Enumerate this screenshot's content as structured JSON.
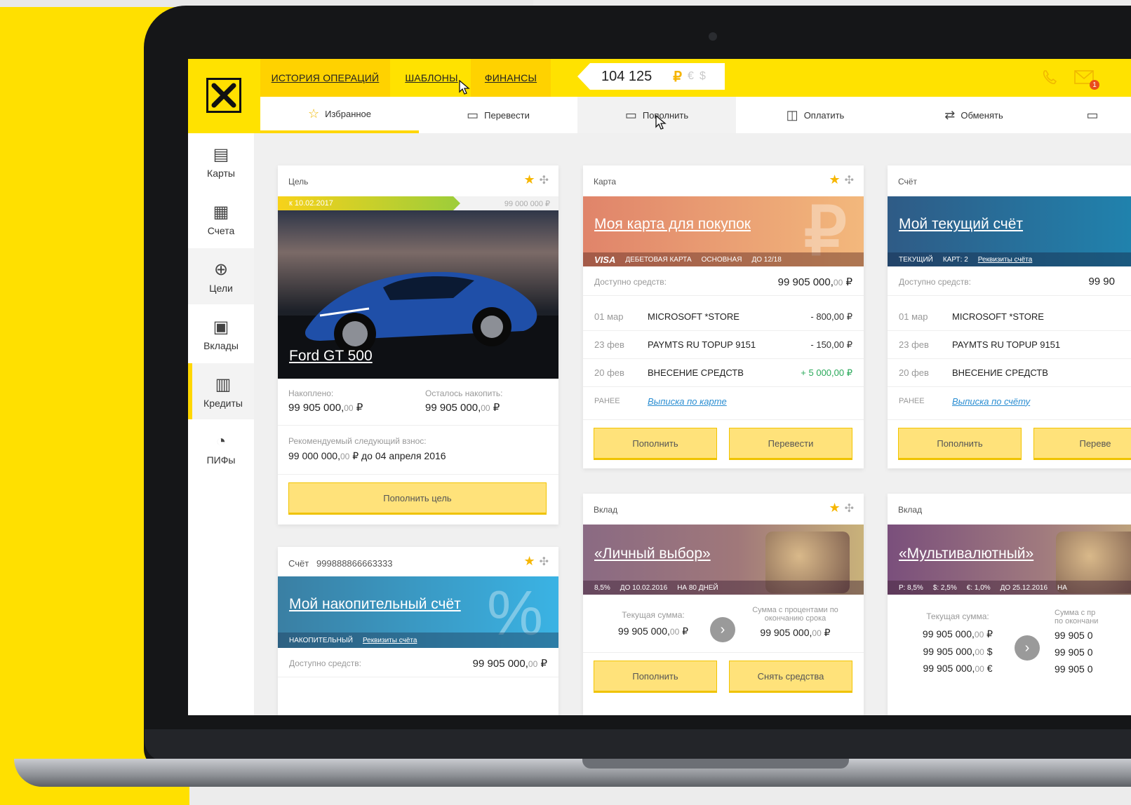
{
  "header": {
    "tabs": [
      {
        "label": "ИСТОРИЯ ОПЕРАЦИЙ"
      },
      {
        "label": "ШАБЛОНЫ"
      },
      {
        "label": "ФИНАНСЫ"
      }
    ],
    "balance": {
      "value": "104 125",
      "currency_active": "₽",
      "currency_alt1": "€",
      "currency_alt2": "$"
    },
    "mail_badge": "1"
  },
  "actions": [
    {
      "label": "Избранное",
      "icon": "star-icon"
    },
    {
      "label": "Перевести",
      "icon": "transfer-icon"
    },
    {
      "label": "Пополнить",
      "icon": "topup-icon"
    },
    {
      "label": "Оплатить",
      "icon": "pay-icon"
    },
    {
      "label": "Обменять",
      "icon": "exchange-icon"
    }
  ],
  "sidebar": [
    {
      "label": "Карты",
      "icon": "cards-icon"
    },
    {
      "label": "Счета",
      "icon": "accounts-icon"
    },
    {
      "label": "Цели",
      "icon": "goals-icon"
    },
    {
      "label": "Вклады",
      "icon": "deposits-icon"
    },
    {
      "label": "Кредиты",
      "icon": "credits-icon"
    },
    {
      "label": "ПИФы",
      "icon": "funds-icon"
    }
  ],
  "goal_card": {
    "type": "Цель",
    "date": "к 10.02.2017",
    "target": "99 000 000 ₽",
    "progress": 0.65,
    "title": "Ford GT 500",
    "saved_label": "Накоплено:",
    "saved_int": "99 905 000,",
    "saved_dec": "00",
    "saved_cur": "₽",
    "left_label": "Осталось накопить:",
    "left_int": "99 905 000,",
    "left_dec": "00",
    "left_cur": "₽",
    "rec_label": "Рекомендуемый следующий взнос:",
    "rec_int": "99 000 000,",
    "rec_dec": "00",
    "rec_tail": "₽ до 04 апреля 2016",
    "button": "Пополнить цель"
  },
  "savings_card": {
    "type": "Счёт",
    "number": "999888866663333",
    "title": "Мой накопительный счёт",
    "strip_kind": "накопительный",
    "strip_link": "Реквизиты счёта",
    "avail_label": "Доступно средств:",
    "avail_int": "99 905 000,",
    "avail_dec": "00",
    "avail_cur": "₽"
  },
  "card_card": {
    "type": "Карта",
    "title": "Моя карта для покупок",
    "strip": [
      "VISA",
      "ДЕБЕТОВАЯ КАРТА",
      "ОСНОВНАЯ",
      "ДО 12/18"
    ],
    "avail_label": "Доступно средств:",
    "avail_int": "99 905 000,",
    "avail_dec": "00",
    "avail_cur": "₽",
    "transactions": [
      {
        "date": "01 мар",
        "name": "MICROSOFT *STORE",
        "amount": "- 800,00 ₽"
      },
      {
        "date": "23 фев",
        "name": "PAYMTS RU TOPUP 9151",
        "amount": "- 150,00 ₽"
      },
      {
        "date": "20 фев",
        "name": "ВНЕСЕНИЕ СРЕДСТВ",
        "amount": "+ 5 000,00 ₽"
      }
    ],
    "earlier": "РАНЕЕ",
    "statement": "Выписка по карте",
    "btn1": "Пополнить",
    "btn2": "Перевести"
  },
  "current_card": {
    "type": "Счёт",
    "title": "Мой текущий счёт",
    "strip": [
      "ТЕКУЩИЙ",
      "КАРТ: 2",
      "Реквизиты счёта"
    ],
    "avail_label": "Доступно средств:",
    "avail_value": "99 90",
    "transactions": [
      {
        "date": "01 мар",
        "name": "MICROSOFT *STORE"
      },
      {
        "date": "23 фев",
        "name": "PAYMTS RU TOPUP 9151"
      },
      {
        "date": "20 фев",
        "name": "ВНЕСЕНИЕ СРЕДСТВ"
      }
    ],
    "earlier": "РАНЕЕ",
    "statement": "Выписка по счёту",
    "btn1": "Пополнить",
    "btn2": "Переве"
  },
  "deposit1": {
    "type": "Вклад",
    "title": "«Личный выбор»",
    "strip": [
      "8,5%",
      "ДО 10.02.2016",
      "НА 80 ДНЕЙ"
    ],
    "cur_label": "Текущая сумма:",
    "cur_int": "99 905 000,",
    "cur_dec": "00",
    "cur_cur": "₽",
    "end_label": "Сумма с процентами по окончанию срока",
    "end_int": "99 905 000,",
    "end_dec": "00",
    "end_cur": "₽",
    "btn1": "Пополнить",
    "btn2": "Снять средства"
  },
  "deposit2": {
    "type": "Вклад",
    "title": "«Мультивалютный»",
    "strip": [
      "Р: 8,5%",
      "$: 2,5%",
      "€: 1,0%",
      "ДО 25.12.2016",
      "НА"
    ],
    "cur_label": "Текущая сумма:",
    "rows": [
      {
        "int": "99 905 000,",
        "dec": "00",
        "cur": "₽"
      },
      {
        "int": "99 905 000,",
        "dec": "00",
        "cur": "$"
      },
      {
        "int": "99 905 000,",
        "dec": "00",
        "cur": "€"
      }
    ],
    "end_label_1": "Сумма с пр",
    "end_label_2": "по окончани",
    "end_value": "99 905 0"
  },
  "colors": {
    "brand": "#ffe200",
    "accent": "#ffd200",
    "button": "#ffe27a",
    "positive": "#2aa95a",
    "link": "#2b8ed2"
  }
}
